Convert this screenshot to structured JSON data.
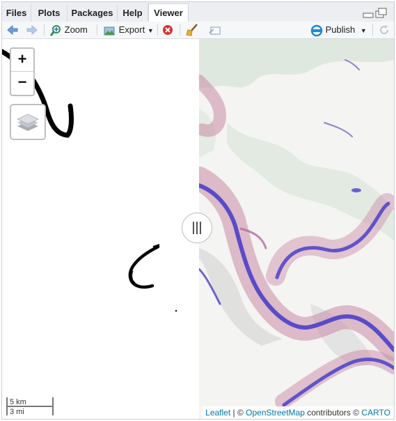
{
  "tabs": [
    {
      "label": "Files"
    },
    {
      "label": "Plots"
    },
    {
      "label": "Packages"
    },
    {
      "label": "Help"
    },
    {
      "label": "Viewer",
      "active": true
    }
  ],
  "toolbar": {
    "zoom_label": "Zoom",
    "export_label": "Export",
    "publish_label": "Publish"
  },
  "map": {
    "zoom_in_label": "+",
    "zoom_out_label": "−",
    "scale_km": "5 km",
    "scale_mi": "3 mi",
    "attribution": {
      "leaflet": "Leaflet",
      "sep1": " | © ",
      "osm": "OpenStreetMap",
      "contributors": " contributors © ",
      "carto": "CARTO"
    },
    "colors": {
      "river_blue": "#4a3fc9",
      "pink_overlay": "#c98aa6",
      "land_green": "#dfe8df",
      "background": "#f4f4f2"
    }
  },
  "icons": [
    "back-arrow-icon",
    "forward-arrow-icon",
    "zoom-icon",
    "export-icon",
    "stop-icon",
    "broom-icon",
    "popout-icon",
    "publish-icon",
    "refresh-icon",
    "minimize-icon",
    "maximize-icon",
    "layers-icon"
  ]
}
